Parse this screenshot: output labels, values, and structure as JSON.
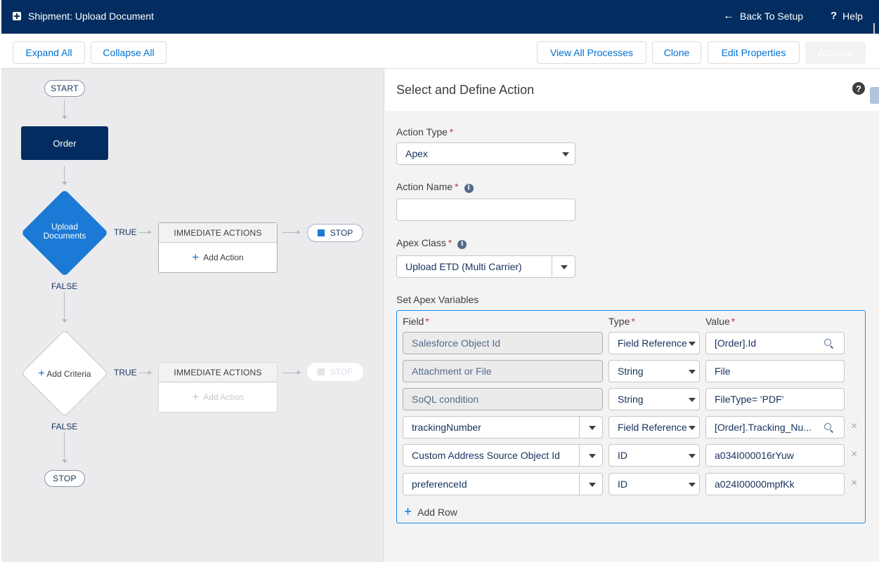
{
  "header": {
    "title": "Shipment: Upload Document",
    "back_label": "Back To Setup",
    "help_label": "Help"
  },
  "toolbar": {
    "expand_all": "Expand All",
    "collapse_all": "Collapse All",
    "view_all_processes": "View All Processes",
    "clone": "Clone",
    "edit_properties": "Edit Properties",
    "activate": "Activate"
  },
  "canvas": {
    "start": "START",
    "object_node": "Order",
    "criteria1": {
      "label": "Upload Documents",
      "true_label": "TRUE",
      "false_label": "FALSE"
    },
    "criteria2": {
      "label": "Add Criteria",
      "true_label": "TRUE",
      "false_label": "FALSE"
    },
    "immediate_actions_label": "IMMEDIATE ACTIONS",
    "add_action_label": "Add Action",
    "stop_label": "STOP",
    "end_stop": "STOP"
  },
  "panel": {
    "title": "Select and Define Action",
    "action_type_label": "Action Type",
    "action_type_value": "Apex",
    "action_name_label": "Action Name",
    "action_name_value": "",
    "apex_class_label": "Apex Class",
    "apex_class_value": "Upload ETD (Multi Carrier)",
    "vars_label": "Set Apex Variables",
    "columns": {
      "field": "Field",
      "type": "Type",
      "value": "Value"
    },
    "rows": [
      {
        "field": "Salesforce Object Id",
        "type": "Field Reference",
        "value": "[Order].Id"
      },
      {
        "field": "Attachment or File",
        "type": "String",
        "value": "File"
      },
      {
        "field": "SoQL condition",
        "type": "String",
        "value": "FileType= 'PDF'"
      },
      {
        "field": "trackingNumber",
        "type": "Field Reference",
        "value": "[Order].Tracking_Nu..."
      },
      {
        "field": "Custom Address Source Object Id",
        "type": "ID",
        "value": "a034I000016rYuw"
      },
      {
        "field": "preferenceId",
        "type": "ID",
        "value": "a024I00000mpfKk"
      }
    ],
    "add_row": "Add Row"
  }
}
